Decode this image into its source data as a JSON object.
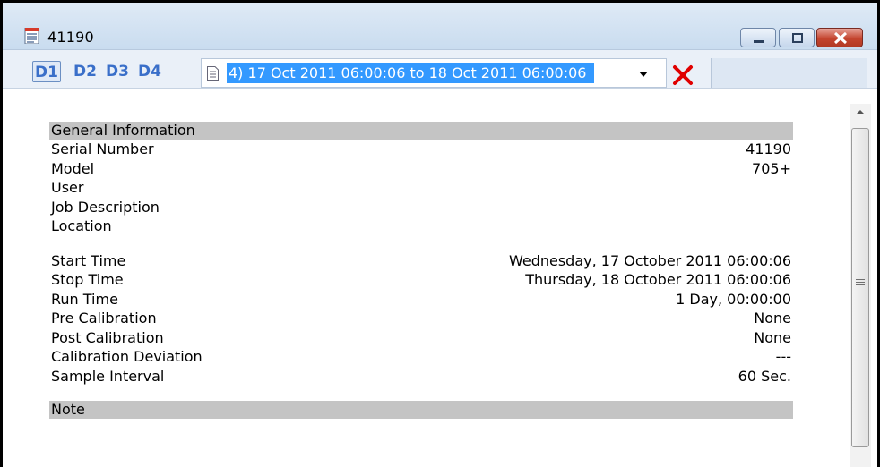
{
  "window": {
    "title": "41190",
    "controls": {
      "minimize_icon": "minimize-icon",
      "maximize_icon": "maximize-icon",
      "close_icon": "close-icon"
    }
  },
  "toolbar": {
    "tabs": [
      {
        "label": "D1",
        "active": true
      },
      {
        "label": "D2",
        "active": false
      },
      {
        "label": "D3",
        "active": false
      },
      {
        "label": "D4",
        "active": false
      }
    ],
    "dataset_select": {
      "value": "4) 17 Oct 2011 06:00:06 to 18 Oct 2011 06:00:06",
      "icon": "document-icon"
    },
    "delete_icon": "red-x-icon"
  },
  "report": {
    "general_header": "General Information",
    "rows_a": [
      {
        "label": "Serial Number",
        "value": "41190"
      },
      {
        "label": "Model",
        "value": "705+"
      },
      {
        "label": "User",
        "value": ""
      },
      {
        "label": "Job Description",
        "value": ""
      },
      {
        "label": "Location",
        "value": ""
      }
    ],
    "rows_b": [
      {
        "label": "Start Time",
        "value": "Wednesday, 17 October 2011 06:00:06"
      },
      {
        "label": "Stop Time",
        "value": "Thursday, 18 October 2011 06:00:06"
      },
      {
        "label": "Run Time",
        "value": "1 Day, 00:00:00"
      },
      {
        "label": "Pre Calibration",
        "value": "None"
      },
      {
        "label": "Post Calibration",
        "value": "None"
      },
      {
        "label": "Calibration Deviation",
        "value": "---"
      },
      {
        "label": "Sample Interval",
        "value": "60 Sec."
      }
    ],
    "note_header": "Note"
  },
  "colors": {
    "selection": "#3399ff",
    "section_band": "#c4c4c4",
    "tab_text": "#3a6fc9",
    "delete": "#e00000"
  }
}
